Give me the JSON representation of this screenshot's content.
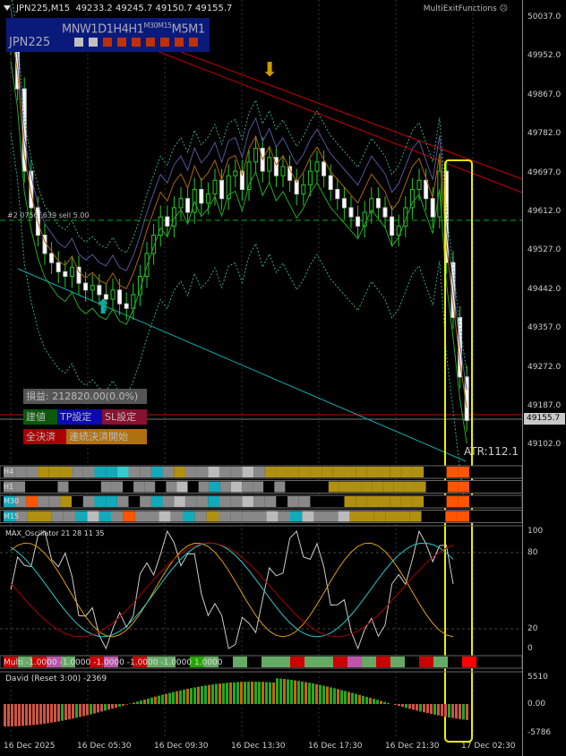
{
  "header": {
    "symbol_tf": "JPN225,M15",
    "ohlc": "49233.2 49245.7 49150.7 49155.7",
    "indicator": "MultiExitFunctions",
    "status_icon": "frown-icon"
  },
  "tf_panel": {
    "symbol": "JPN225",
    "timeframes": [
      "MN",
      "W1",
      "D1",
      "H4",
      "H1",
      "M30",
      "M15",
      "M5",
      "M1"
    ],
    "states": [
      "#c0c0c0",
      "#c0c0c0",
      "#c03000",
      "#c03000",
      "#c03000",
      "#c03000",
      "#c03000",
      "#c03000",
      "#c03000"
    ]
  },
  "order_line": "#2 0756 ,639 sell 5.00",
  "price_axis": [
    "50037.0",
    "49952.0",
    "49867.0",
    "49782.0",
    "49697.0",
    "49612.0",
    "49527.0",
    "49442.0",
    "49357.0",
    "49272.0",
    "49187.0",
    "49102.0"
  ],
  "current_price": "49155.7",
  "atr": "ATR:112.1",
  "trade_panel": {
    "pnl": "損益: 212820.00(0.0%)",
    "entry": "建値",
    "tp": "TP設定",
    "sl": "SL設定",
    "close_all": "全決済",
    "continuous": "連続決済開始"
  },
  "heat_rows": [
    {
      "label": "H4",
      "cells": "gggyyyggcctggcgyggwggwgyyyyyyyyyyyyyy..oo"
    },
    {
      "label": "H1",
      "cells": "gg...g...gg.gg.gw.gcgwgg.g....yyyyyyyyy..oo"
    },
    {
      "label": "M30",
      "cells": "cgoggy.gccg.gcgwggcggwgg.gg...yyyyyyy..oo"
    },
    {
      "label": "M15",
      "cells": "cgyyggcwcgoggwgcgyggggwgcwggwyyyyyy..oo"
    }
  ],
  "oscillator": {
    "title": "MAX_Oscillator 21 28 11 35",
    "levels": [
      "100",
      "80",
      "20",
      "0"
    ]
  },
  "multi": {
    "label": "Multi",
    "values": [
      "-1.0000",
      "-1.0000",
      "-1.0000",
      "-1.0000",
      "-1.0000",
      "1.0000"
    ]
  },
  "david": {
    "title": "David (Reset 3:00) -2369",
    "levels": [
      "5510",
      "0.00",
      "-5786"
    ]
  },
  "time_axis": [
    "16 Dec 2025",
    "16 Dec 05:30",
    "16 Dec 09:30",
    "16 Dec 13:30",
    "16 Dec 17:30",
    "16 Dec 21:30",
    "17 Dec 02:30"
  ],
  "chart_data": {
    "type": "candlestick",
    "closes": [
      49980,
      49880,
      49700,
      49620,
      49560,
      49520,
      49500,
      49480,
      49470,
      49490,
      49455,
      49440,
      49450,
      49430,
      49420,
      49440,
      49410,
      49400,
      49430,
      49470,
      49520,
      49560,
      49600,
      49580,
      49620,
      49640,
      49610,
      49660,
      49630,
      49650,
      49680,
      49640,
      49690,
      49700,
      49660,
      49720,
      49750,
      49700,
      49730,
      49690,
      49710,
      49680,
      49650,
      49670,
      49700,
      49720,
      49690,
      49660,
      49640,
      49620,
      49600,
      49580,
      49610,
      49640,
      49620,
      49600,
      49560,
      49580,
      49620,
      49660,
      49680,
      49640,
      49600,
      49700,
      49500,
      49380,
      49250,
      49155
    ],
    "ylim": [
      49060,
      50060
    ]
  }
}
